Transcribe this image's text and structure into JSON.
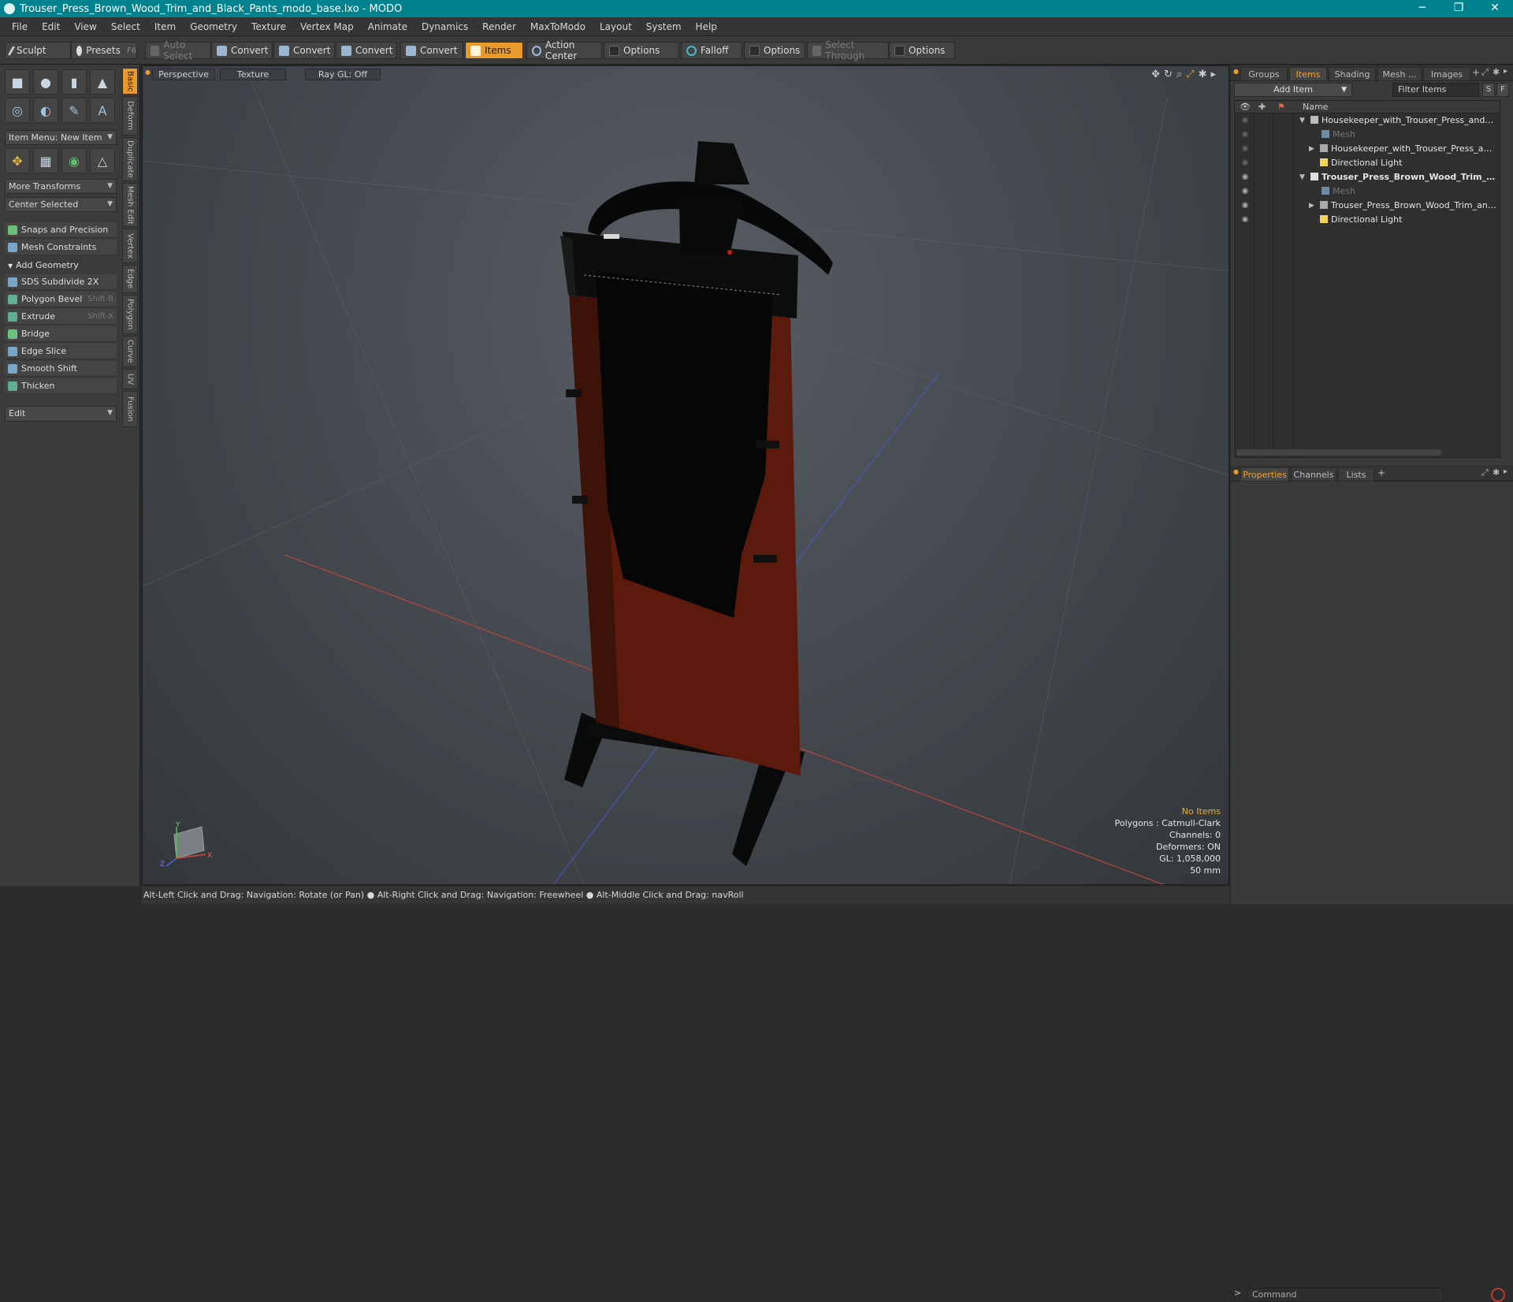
{
  "window": {
    "title": "Trouser_Press_Brown_Wood_Trim_and_Black_Pants_modo_base.lxo - MODO",
    "min": "─",
    "max": "❐",
    "close": "✕"
  },
  "menu": [
    "File",
    "Edit",
    "View",
    "Select",
    "Item",
    "Geometry",
    "Texture",
    "Vertex Map",
    "Animate",
    "Dynamics",
    "Render",
    "MaxToModo",
    "Layout",
    "System",
    "Help"
  ],
  "toolbar": {
    "sculpt": "Sculpt",
    "presets": "Presets",
    "presets_shortcut": "F6",
    "auto_select": "Auto Select",
    "convert1": "Convert",
    "convert2": "Convert",
    "convert3": "Convert",
    "convert4": "Convert",
    "items": "Items",
    "action_center": "Action Center",
    "options1": "Options",
    "falloff": "Falloff",
    "options2": "Options",
    "select_through": "Select Through",
    "options3": "Options"
  },
  "left": {
    "item_menu": "Item Menu: New Item",
    "more_transforms": "More Transforms",
    "center_selected": "Center Selected",
    "snaps": "Snaps and Precision",
    "mesh_constraints": "Mesh Constraints",
    "add_geometry": "Add Geometry",
    "tools": [
      {
        "label": "SDS Subdivide 2X",
        "shortcut": ""
      },
      {
        "label": "Polygon Bevel",
        "shortcut": "Shift-B"
      },
      {
        "label": "Extrude",
        "shortcut": "Shift-X"
      },
      {
        "label": "Bridge",
        "shortcut": ""
      },
      {
        "label": "Edge Slice",
        "shortcut": ""
      },
      {
        "label": "Smooth Shift",
        "shortcut": ""
      },
      {
        "label": "Thicken",
        "shortcut": ""
      }
    ],
    "edit": "Edit",
    "vtabs": [
      "Basic",
      "Deform",
      "Duplicate",
      "Mesh Edit",
      "Vertex",
      "Edge",
      "Polygon",
      "Curve",
      "UV",
      "Fusion"
    ]
  },
  "viewport": {
    "perspective": "Perspective",
    "texture": "Texture",
    "raygl": "Ray GL: Off",
    "info": {
      "no_items": "No Items",
      "polygons": "Polygons : Catmull-Clark",
      "channels": "Channels: 0",
      "deformers": "Deformers: ON",
      "gl": "GL: 1,058,000",
      "focal": "50 mm"
    },
    "axis": {
      "y": "Y",
      "x": "X",
      "z": "Z"
    }
  },
  "status": "Alt-Left Click and Drag: Navigation: Rotate (or Pan) ● Alt-Right Click and Drag: Navigation: Freewheel ● Alt-Middle Click and Drag: navRoll",
  "right": {
    "tabs": [
      "Groups",
      "Items",
      "Shading",
      "Mesh ...",
      "Images"
    ],
    "add_item": "Add Item",
    "filter": "Filter Items",
    "s": "S",
    "f": "F",
    "name_col": "Name",
    "tree": [
      {
        "label": "Housekeeper_with_Trouser_Press_and_Cl ...",
        "indent": 1,
        "arrow": "▼",
        "type": "scene",
        "dim": false,
        "bold": false
      },
      {
        "label": "Mesh",
        "indent": 2,
        "arrow": "",
        "type": "mesh",
        "dim": true,
        "bold": false
      },
      {
        "label": "Housekeeper_with_Trouser_Press_and_...",
        "indent": 2,
        "arrow": "▶",
        "type": "group",
        "dim": false,
        "bold": false
      },
      {
        "label": "Directional Light",
        "indent": 2,
        "arrow": "",
        "type": "light",
        "dim": false,
        "bold": false
      },
      {
        "label": "Trouser_Press_Brown_Wood_Trim_ ...",
        "indent": 1,
        "arrow": "▼",
        "type": "scene",
        "dim": false,
        "bold": true
      },
      {
        "label": "Mesh",
        "indent": 2,
        "arrow": "",
        "type": "mesh",
        "dim": true,
        "bold": false
      },
      {
        "label": "Trouser_Press_Brown_Wood_Trim_and_...",
        "indent": 2,
        "arrow": "▶",
        "type": "group",
        "dim": false,
        "bold": false
      },
      {
        "label": "Directional Light",
        "indent": 2,
        "arrow": "",
        "type": "light",
        "dim": false,
        "bold": false
      }
    ],
    "props_tabs": [
      "Properties",
      "Channels",
      "Lists"
    ],
    "command_placeholder": "Command"
  },
  "colors": {
    "accent": "#e89a2c",
    "titlebar": "#00838f",
    "wood": "#6b1e0e"
  }
}
